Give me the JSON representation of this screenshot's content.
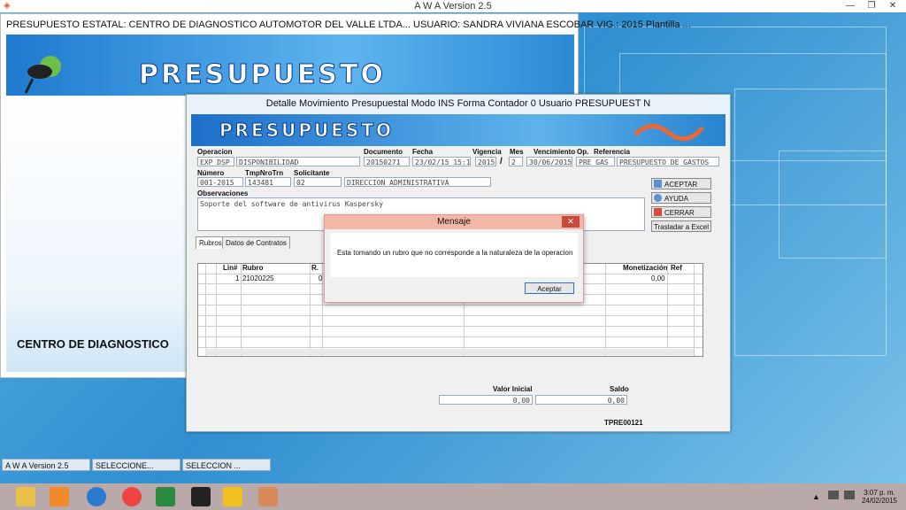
{
  "app": {
    "window_title": "A W A Version 2.5",
    "caption": "PRESUPUESTO ESTATAL: CENTRO DE DIAGNOSTICO AUTOMOTOR DEL VALLE LTDA... USUARIO: SANDRA VIVIANA ESCOBAR VIG.:      2015  Plantilla  ...",
    "banner_title": "PRESUPUESTO",
    "company": "CENTRO DE DIAGNOSTICO"
  },
  "detail": {
    "title": "Detalle Movimiento Presupuestal Modo INS Forma  Contador 0 Usuario PRESUPUEST    N",
    "banner_title": "PRESUPUESTO",
    "labels": {
      "operacion": "Operacion",
      "documento": "Documento",
      "fecha": "Fecha",
      "vigencia": "Vigencia",
      "mes": "Mes",
      "vencimiento": "Vencimiento",
      "op": "Op.",
      "referencia": "Referencia",
      "numero": "Número",
      "tmpnrotrn": "TmpNroTrn",
      "solicitante": "Solicitante",
      "observaciones": "Observaciones"
    },
    "values": {
      "op_code": "EXP_DSP",
      "op_name": "DISPONIBILIDAD",
      "documento": "20150271",
      "fecha": "23/02/15 15:14",
      "vigencia": "2015",
      "slash": "/",
      "mes": "2",
      "vencimiento": "30/06/2015",
      "op": "PRE_GAS",
      "referencia": "PRESUPUESTO DE GASTOS",
      "numero": "001-2015",
      "tmpnrotrn": "143481",
      "solicitante_code": "02",
      "solicitante_name": "DIRECCION  ADMINISTRATIVA",
      "observaciones": "Soporte del software de antivirus Kaspersky"
    },
    "buttons": {
      "aceptar": "ACEPTAR",
      "ayuda": "AYUDA",
      "cerrar": "CERRAR",
      "excel": "Trasladar a Excel"
    },
    "tabs": [
      "Rubros",
      "Datos de Contratos"
    ],
    "grid": {
      "headers": [
        "Lin#",
        "Rubro",
        "R.",
        "Monetización",
        "Ref"
      ],
      "row": {
        "lin": "1",
        "rubro": "21020225",
        "r": "0",
        "monetizacion": "0,00"
      }
    },
    "totals": {
      "valor_inicial_label": "Valor Inicial",
      "saldo_label": "Saldo",
      "valor_inicial": "0,00",
      "saldo": "0,00"
    },
    "footer_code": "TPRE00121"
  },
  "message": {
    "title": "Mensaje",
    "close": "✕",
    "text": "Esta tomando un rubro que no corresponde a la naturaleza de la operacion",
    "button": "Aceptar"
  },
  "taskbar_windows": [
    "A W A Version 2.5",
    "SELECCIONE...",
    "SELECCION ..."
  ],
  "clock": {
    "time": "3:07 p. m.",
    "date": "24/02/2015"
  },
  "colors": {
    "banner": "#1f7ad0",
    "message_title": "#f2b7a6",
    "taskbar": "#b9a9a8"
  }
}
